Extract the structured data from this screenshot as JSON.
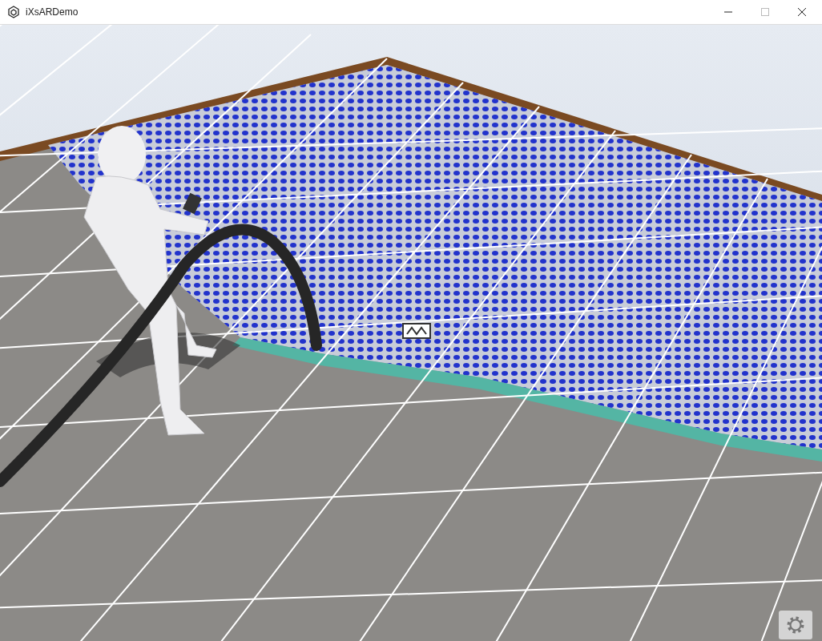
{
  "window": {
    "title": "iXsARDemo"
  }
}
